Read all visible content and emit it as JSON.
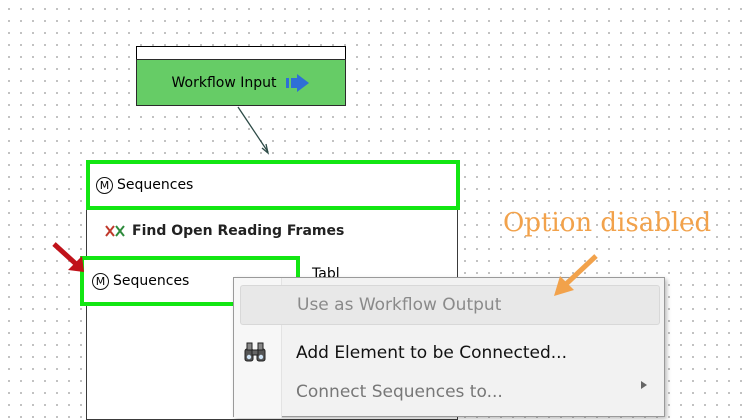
{
  "workflow_input": {
    "label": "Workflow Input",
    "color": "#66cc66",
    "icon": "right-arrow-icon"
  },
  "element": {
    "input_port": {
      "badge": "M",
      "label": "Sequences"
    },
    "title": "Find Open Reading Frames",
    "title_icon": "orf-icon",
    "output_port": {
      "badge": "M",
      "label": "Sequences"
    },
    "second_output_label": "Tabl",
    "highlight_color": "#12e612"
  },
  "annotation": {
    "text": "Option disabled",
    "color": "#f2a24b"
  },
  "context_menu": {
    "items": [
      {
        "label": "Use as Workflow Output",
        "enabled": false
      },
      {
        "label": "Add Element to be Connected...",
        "enabled": true,
        "icon": "binoculars-icon"
      },
      {
        "label": "Connect Sequences to...",
        "enabled": false,
        "submenu": true
      }
    ]
  },
  "pointer_colors": {
    "red_arrow": "#c0121a",
    "orange_arrow": "#f2a24b"
  }
}
